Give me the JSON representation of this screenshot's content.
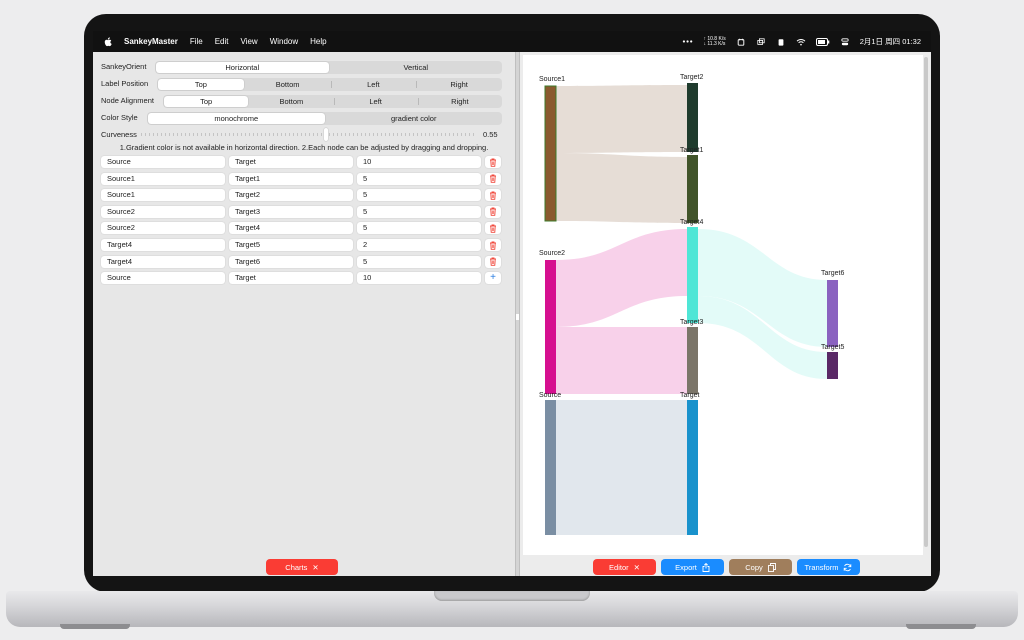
{
  "menubar": {
    "app_name": "SankeyMaster",
    "menus": [
      "File",
      "Edit",
      "View",
      "Window",
      "Help"
    ],
    "network": {
      "up": "↑ 10.8",
      "down": "↓ 11.3",
      "unit": "K/s"
    },
    "datetime": "2月1日 周四  01:32"
  },
  "settings": {
    "orient": {
      "label": "SankeyOrient",
      "options": [
        "Horizontal",
        "Vertical"
      ],
      "selected": "Horizontal"
    },
    "label_position": {
      "label": "Label Position",
      "options": [
        "Top",
        "Bottom",
        "Left",
        "Right"
      ],
      "selected": "Top"
    },
    "node_alignment": {
      "label": "Node Alignment",
      "options": [
        "Top",
        "Bottom",
        "Left",
        "Right"
      ],
      "selected": "Top"
    },
    "color_style": {
      "label": "Color Style",
      "options": [
        "monochrome",
        "gradient color"
      ],
      "selected": "monochrome"
    },
    "curveness": {
      "label": "Curveness",
      "value": "0.55",
      "fraction": 0.55
    },
    "note": "1.Gradient color is not available in horizontal direction. 2.Each node can be adjusted by dragging and dropping."
  },
  "links": [
    {
      "source": "Source",
      "target": "Target",
      "value": "10"
    },
    {
      "source": "Source1",
      "target": "Target1",
      "value": "5"
    },
    {
      "source": "Source1",
      "target": "Target2",
      "value": "5"
    },
    {
      "source": "Source2",
      "target": "Target3",
      "value": "5"
    },
    {
      "source": "Source2",
      "target": "Target4",
      "value": "5"
    },
    {
      "source": "Target4",
      "target": "Target5",
      "value": "2"
    },
    {
      "source": "Target4",
      "target": "Target6",
      "value": "5"
    }
  ],
  "new_link": {
    "source": "Source",
    "target": "Target",
    "value": "10"
  },
  "buttons": {
    "charts": "Charts",
    "editor": "Editor",
    "export": "Export",
    "copy": "Copy",
    "transform": "Transform"
  },
  "colors": {
    "red": "#fa3c34",
    "blue": "#1a8cff",
    "brown": "#a07e5c"
  },
  "sankey": {
    "nodes": [
      {
        "name": "Source1",
        "color": "#8a5a2e"
      },
      {
        "name": "Target2",
        "color": "#1f3b2d"
      },
      {
        "name": "Target1",
        "color": "#41542a"
      },
      {
        "name": "Target4",
        "color": "#4fe6d6"
      },
      {
        "name": "Source2",
        "color": "#d60f8f"
      },
      {
        "name": "Target3",
        "color": "#7b7569"
      },
      {
        "name": "Target6",
        "color": "#8a62c0"
      },
      {
        "name": "Target5",
        "color": "#5a2866"
      },
      {
        "name": "Source",
        "color": "#7a8ea3"
      },
      {
        "name": "Target",
        "color": "#1992cc"
      }
    ]
  }
}
